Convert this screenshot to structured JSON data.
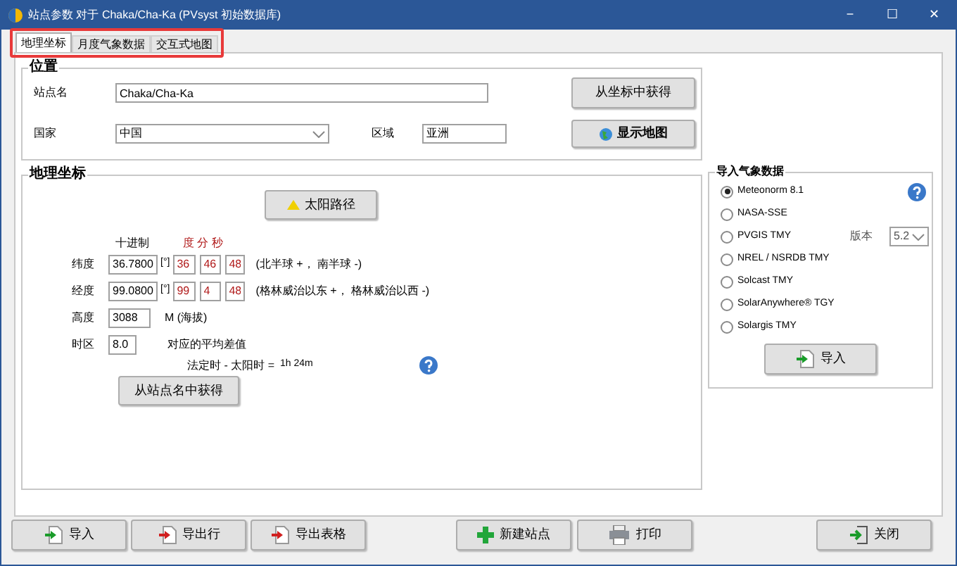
{
  "window": {
    "title": "站点参数 对于 Chaka/Cha-Ka (PVsyst 初始数据库)",
    "controls": [
      "−",
      "☐",
      "✕"
    ]
  },
  "tabs": [
    {
      "label": "地理坐标",
      "selected": true
    },
    {
      "label": "月度气象数据",
      "selected": false
    },
    {
      "label": "交互式地图",
      "selected": false
    }
  ],
  "location": {
    "title": "位置",
    "site_label": "站点名",
    "site_value": "Chaka/Cha-Ka",
    "country_label": "国家",
    "country_value": "中国",
    "region_label": "区域",
    "region_value": "亚洲",
    "from_coords_button": "从坐标中获得",
    "show_map_button": "显示地图"
  },
  "geo": {
    "title": "地理坐标",
    "sun_path_button": "太阳路径",
    "decimal_header": "十进制",
    "dms_header": "度 分 秒",
    "rows": [
      {
        "label": "纬度",
        "decimal": "36.7800",
        "unit": "[°]",
        "deg": "36",
        "min": "46",
        "sec": "48",
        "note": "(北半球 +， 南半球 -)"
      },
      {
        "label": "经度",
        "decimal": "99.0800",
        "unit": "[°]",
        "deg": "99",
        "min": "4",
        "sec": "48",
        "note": "(格林威治以东 +， 格林威治以西 -)"
      }
    ],
    "altitude_label": "高度",
    "altitude_value": "3088",
    "altitude_unit": "M (海拔)",
    "timezone_label": "时区",
    "timezone_value": "8.0",
    "timezone_note": "对应的平均差值",
    "legal_solar": "法定时 - 太阳时 =",
    "legal_solar_value": "1h 24m",
    "from_site_button": "从站点名中获得"
  },
  "weather_import": {
    "title": "导入气象数据",
    "options": [
      {
        "label": "Meteonorm 8.1",
        "selected": true
      },
      {
        "label": "NASA-SSE",
        "selected": false
      },
      {
        "label": "PVGIS TMY",
        "selected": false
      },
      {
        "label": "NREL / NSRDB TMY",
        "selected": false
      },
      {
        "label": "Solcast TMY",
        "selected": false
      },
      {
        "label": "SolarAnywhere® TGY",
        "selected": false
      },
      {
        "label": "Solargis TMY",
        "selected": false
      }
    ],
    "version_label": "版本",
    "version_value": "5.2",
    "import_button": "导入"
  },
  "bottom_buttons": [
    {
      "label": "导入",
      "kind": "import"
    },
    {
      "label": "导出行",
      "kind": "export"
    },
    {
      "label": "导出表格",
      "kind": "export"
    },
    {
      "label": "新建站点",
      "kind": "new"
    },
    {
      "label": "打印",
      "kind": "print"
    },
    {
      "label": "关闭",
      "kind": "close"
    }
  ]
}
